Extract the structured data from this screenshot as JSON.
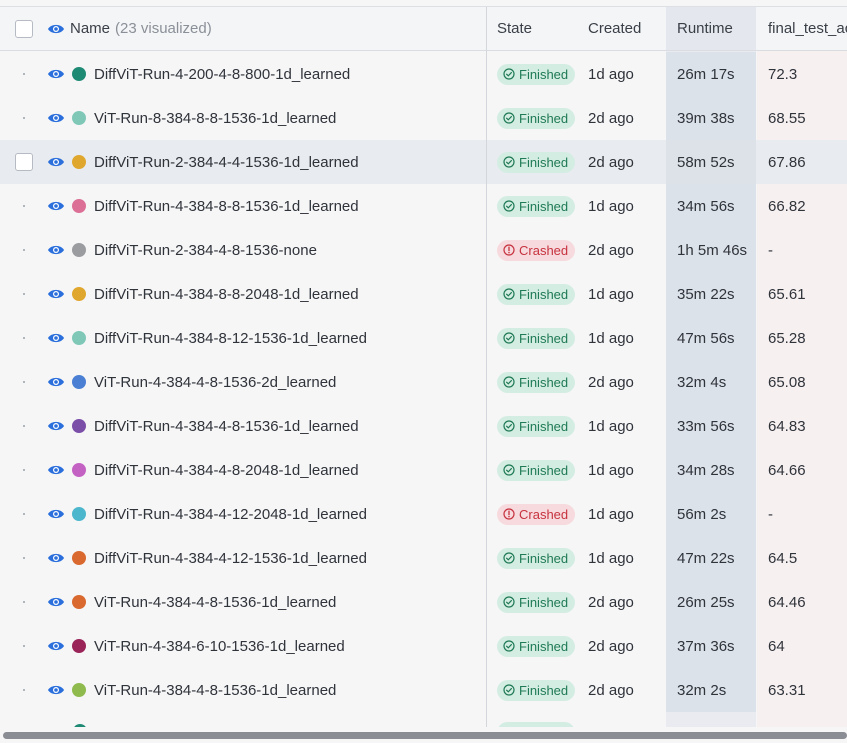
{
  "header": {
    "name_label": "Name",
    "name_count": "(23 visualized)",
    "state_label": "State",
    "created_label": "Created",
    "runtime_label": "Runtime",
    "final_label": "final_test_acc"
  },
  "colors": {
    "finished_bg": "#d4ede3",
    "finished_text": "#1f7a55",
    "crashed_bg": "#f6dadd",
    "crashed_text": "#c7323f",
    "eye": "#2a6fdb"
  },
  "rows": [
    {
      "name": "DiffViT-Run-4-200-4-8-800-1d_learned",
      "color": "#1f8a74",
      "state": "Finished",
      "created": "1d ago",
      "runtime": "26m 17s",
      "final": "72.3"
    },
    {
      "name": "ViT-Run-8-384-8-8-1536-1d_learned",
      "color": "#7fc8b8",
      "state": "Finished",
      "created": "2d ago",
      "runtime": "39m 38s",
      "final": "68.55"
    },
    {
      "name": "DiffViT-Run-2-384-4-4-1536-1d_learned",
      "color": "#e0a72e",
      "state": "Finished",
      "created": "2d ago",
      "runtime": "58m 52s",
      "final": "67.86"
    },
    {
      "name": "DiffViT-Run-4-384-8-8-1536-1d_learned",
      "color": "#dc6f96",
      "state": "Finished",
      "created": "1d ago",
      "runtime": "34m 56s",
      "final": "66.82"
    },
    {
      "name": "DiffViT-Run-2-384-4-8-1536-none",
      "color": "#9a9ca0",
      "state": "Crashed",
      "created": "2d ago",
      "runtime": "1h 5m 46s",
      "final": "-"
    },
    {
      "name": "DiffViT-Run-4-384-8-8-2048-1d_learned",
      "color": "#e0a72e",
      "state": "Finished",
      "created": "1d ago",
      "runtime": "35m 22s",
      "final": "65.61"
    },
    {
      "name": "DiffViT-Run-4-384-8-12-1536-1d_learned",
      "color": "#7fc8b8",
      "state": "Finished",
      "created": "1d ago",
      "runtime": "47m 56s",
      "final": "65.28"
    },
    {
      "name": "ViT-Run-4-384-4-8-1536-2d_learned",
      "color": "#4a7fd4",
      "state": "Finished",
      "created": "2d ago",
      "runtime": "32m 4s",
      "final": "65.08"
    },
    {
      "name": "DiffViT-Run-4-384-4-8-1536-1d_learned",
      "color": "#7b4ea8",
      "state": "Finished",
      "created": "1d ago",
      "runtime": "33m 56s",
      "final": "64.83"
    },
    {
      "name": "DiffViT-Run-4-384-4-8-2048-1d_learned",
      "color": "#c462c4",
      "state": "Finished",
      "created": "1d ago",
      "runtime": "34m 28s",
      "final": "64.66"
    },
    {
      "name": "DiffViT-Run-4-384-4-12-2048-1d_learned",
      "color": "#4bb6cc",
      "state": "Crashed",
      "created": "1d ago",
      "runtime": "56m 2s",
      "final": "-"
    },
    {
      "name": "DiffViT-Run-4-384-4-12-1536-1d_learned",
      "color": "#d9692e",
      "state": "Finished",
      "created": "1d ago",
      "runtime": "47m 22s",
      "final": "64.5"
    },
    {
      "name": "ViT-Run-4-384-4-8-1536-1d_learned",
      "color": "#d9692e",
      "state": "Finished",
      "created": "2d ago",
      "runtime": "26m 25s",
      "final": "64.46"
    },
    {
      "name": "ViT-Run-4-384-6-10-1536-1d_learned",
      "color": "#9a2458",
      "state": "Finished",
      "created": "2d ago",
      "runtime": "37m 36s",
      "final": "64"
    },
    {
      "name": "ViT-Run-4-384-4-8-1536-1d_learned",
      "color": "#8fba4e",
      "state": "Finished",
      "created": "2d ago",
      "runtime": "32m 2s",
      "final": "63.31"
    }
  ],
  "highlighted_row": 2
}
